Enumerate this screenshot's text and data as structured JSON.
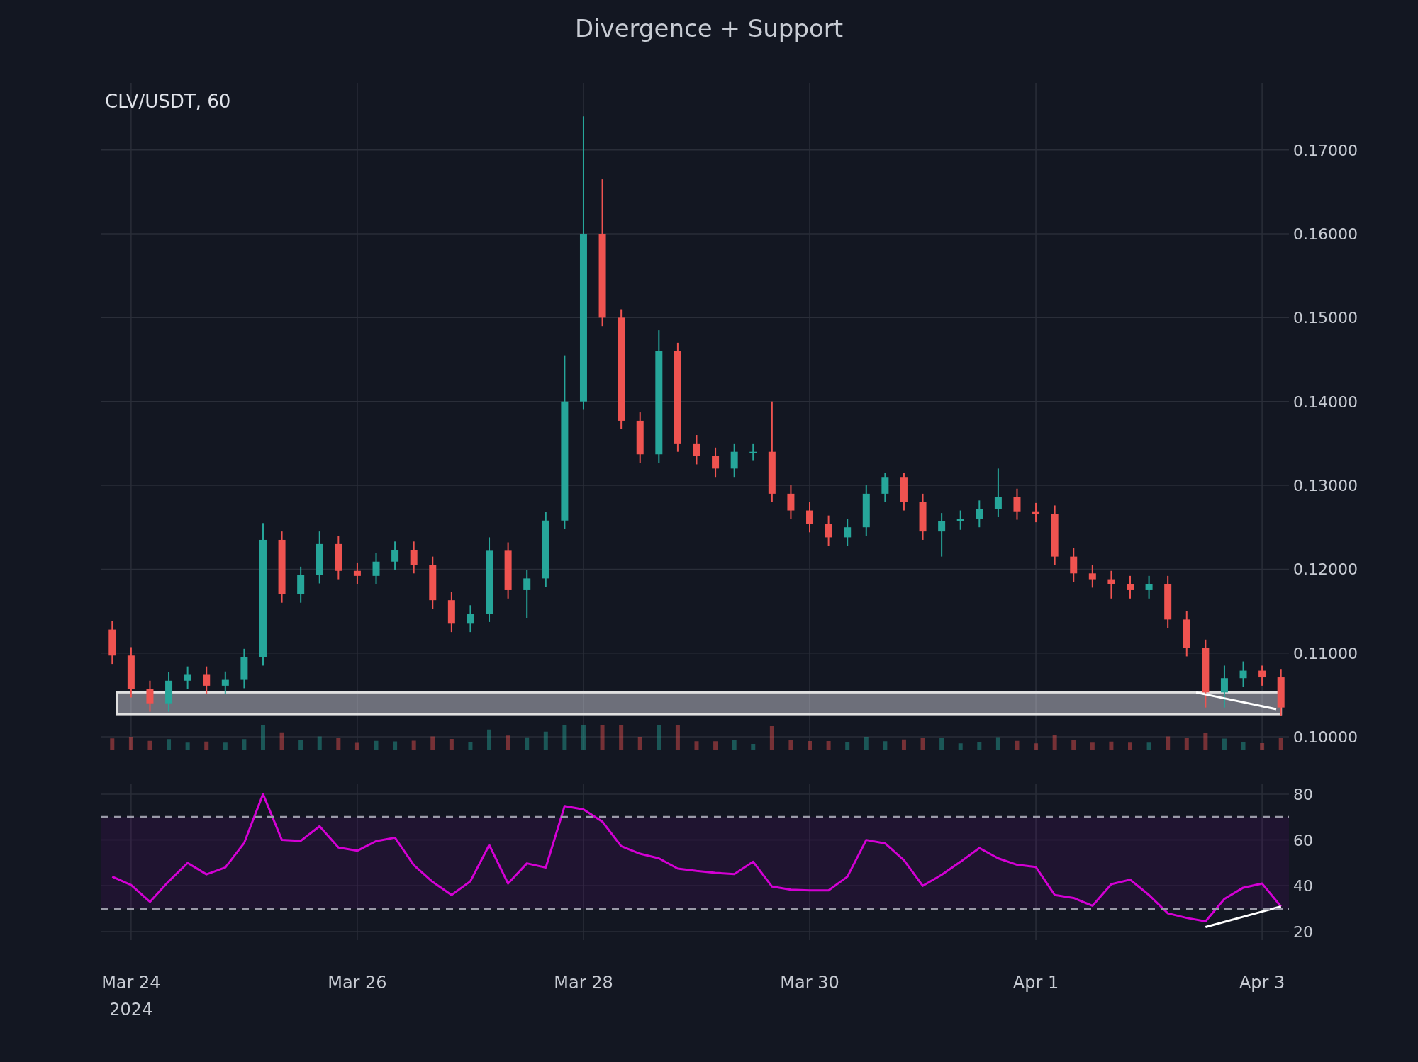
{
  "title": "Divergence + Support",
  "price_panel": {
    "chart_data": {
      "type": "candlestick",
      "title": "CLV/USDT, 60",
      "grid": true,
      "categories": [
        null,
        null,
        null,
        null,
        null,
        null,
        null,
        null,
        null,
        null,
        null,
        null,
        null,
        null,
        null,
        null,
        null,
        null,
        null,
        null,
        null,
        null,
        null,
        null,
        null,
        null,
        null,
        null,
        null,
        null,
        null,
        null,
        null,
        null,
        null,
        null,
        null,
        null,
        null,
        null,
        null,
        null,
        null,
        null,
        null,
        null,
        null,
        null,
        null,
        null,
        null,
        null,
        null,
        null,
        null,
        null,
        null,
        null,
        null,
        null,
        null,
        null,
        null
      ],
      "ohlc": [
        [
          0.1128,
          0.1138,
          0.1087,
          0.1097
        ],
        [
          0.1097,
          0.1107,
          0.1047,
          0.1057
        ],
        [
          0.1057,
          0.1067,
          0.103,
          0.104
        ],
        [
          0.104,
          0.1077,
          0.103,
          0.1067
        ],
        [
          0.1067,
          0.1084,
          0.1057,
          0.1074
        ],
        [
          0.1074,
          0.1084,
          0.1051,
          0.1061
        ],
        [
          0.1061,
          0.1078,
          0.1051,
          0.1068
        ],
        [
          0.1068,
          0.1105,
          0.1058,
          0.1095
        ],
        [
          0.1095,
          0.1255,
          0.1085,
          0.1235
        ],
        [
          0.1235,
          0.1245,
          0.116,
          0.117
        ],
        [
          0.117,
          0.1203,
          0.116,
          0.1193
        ],
        [
          0.1193,
          0.1245,
          0.1183,
          0.123
        ],
        [
          0.123,
          0.124,
          0.1188,
          0.1198
        ],
        [
          0.1198,
          0.1208,
          0.1182,
          0.1192
        ],
        [
          0.1192,
          0.1219,
          0.1182,
          0.1209
        ],
        [
          0.1209,
          0.1233,
          0.1199,
          0.1223
        ],
        [
          0.1223,
          0.1233,
          0.1195,
          0.1205
        ],
        [
          0.1205,
          0.1215,
          0.1153,
          0.1163
        ],
        [
          0.1163,
          0.1173,
          0.1125,
          0.1135
        ],
        [
          0.1135,
          0.1157,
          0.1125,
          0.1147
        ],
        [
          0.1147,
          0.1238,
          0.1137,
          0.1222
        ],
        [
          0.1222,
          0.1232,
          0.1165,
          0.1175
        ],
        [
          0.1175,
          0.1199,
          0.1142,
          0.1189
        ],
        [
          0.1189,
          0.1268,
          0.1179,
          0.1258
        ],
        [
          0.1258,
          0.1455,
          0.1248,
          0.14
        ],
        [
          0.14,
          0.174,
          0.139,
          0.16
        ],
        [
          0.16,
          0.1665,
          0.149,
          0.15
        ],
        [
          0.15,
          0.151,
          0.1367,
          0.1377
        ],
        [
          0.1377,
          0.1387,
          0.1327,
          0.1337
        ],
        [
          0.1337,
          0.1485,
          0.1327,
          0.146
        ],
        [
          0.146,
          0.147,
          0.134,
          0.135
        ],
        [
          0.135,
          0.136,
          0.1325,
          0.1335
        ],
        [
          0.1335,
          0.1345,
          0.131,
          0.132
        ],
        [
          0.132,
          0.135,
          0.131,
          0.134
        ],
        [
          0.134,
          0.135,
          0.133,
          0.134
        ],
        [
          0.134,
          0.14,
          0.128,
          0.129
        ],
        [
          0.129,
          0.13,
          0.126,
          0.127
        ],
        [
          0.127,
          0.128,
          0.1244,
          0.1254
        ],
        [
          0.1254,
          0.1264,
          0.1228,
          0.1238
        ],
        [
          0.1238,
          0.126,
          0.1228,
          0.125
        ],
        [
          0.125,
          0.13,
          0.124,
          0.129
        ],
        [
          0.129,
          0.1315,
          0.128,
          0.131
        ],
        [
          0.131,
          0.1315,
          0.127,
          0.128
        ],
        [
          0.128,
          0.129,
          0.1235,
          0.1245
        ],
        [
          0.1245,
          0.1267,
          0.1215,
          0.1257
        ],
        [
          0.1257,
          0.127,
          0.1247,
          0.126
        ],
        [
          0.126,
          0.1282,
          0.125,
          0.1272
        ],
        [
          0.1272,
          0.132,
          0.1262,
          0.1286
        ],
        [
          0.1286,
          0.1296,
          0.1259,
          0.1269
        ],
        [
          0.1269,
          0.1279,
          0.1256,
          0.1266
        ],
        [
          0.1266,
          0.1276,
          0.1205,
          0.1215
        ],
        [
          0.1215,
          0.1225,
          0.1185,
          0.1195
        ],
        [
          0.1195,
          0.1205,
          0.1178,
          0.1188
        ],
        [
          0.1188,
          0.1198,
          0.1165,
          0.1182
        ],
        [
          0.1182,
          0.1192,
          0.1165,
          0.1175
        ],
        [
          0.1175,
          0.1192,
          0.1165,
          0.1182
        ],
        [
          0.1182,
          0.1192,
          0.113,
          0.114
        ],
        [
          0.114,
          0.115,
          0.1096,
          0.1106
        ],
        [
          0.1106,
          0.1116,
          0.1035,
          0.1053
        ],
        [
          0.1053,
          0.1085,
          0.1035,
          0.107
        ],
        [
          0.107,
          0.109,
          0.106,
          0.1079
        ],
        [
          0.1079,
          0.1085,
          0.1061,
          0.1071
        ],
        [
          0.1071,
          0.1081,
          0.1025,
          0.1035
        ]
      ],
      "ylim": [
        0.0984,
        0.178
      ],
      "yticks": [
        {
          "value": 0.1,
          "label": "0.10000"
        },
        {
          "value": 0.11,
          "label": "0.11000"
        },
        {
          "value": 0.12,
          "label": "0.12000"
        },
        {
          "value": 0.13,
          "label": "0.13000"
        },
        {
          "value": 0.14,
          "label": "0.14000"
        },
        {
          "value": 0.15,
          "label": "0.15000"
        },
        {
          "value": 0.16,
          "label": "0.16000"
        },
        {
          "value": 0.17,
          "label": "0.17000"
        }
      ]
    },
    "support_zone": {
      "kind": "zone"
    },
    "divergence_line": {
      "kind": "trendline"
    }
  },
  "rsi_panel": {
    "chart_data": {
      "type": "line",
      "grid": true,
      "categories": [
        null,
        "Mar 24",
        null,
        null,
        null,
        null,
        null,
        null,
        null,
        null,
        null,
        null,
        null,
        "Mar 26",
        null,
        null,
        null,
        null,
        null,
        null,
        null,
        null,
        null,
        null,
        null,
        "Mar 28",
        null,
        null,
        null,
        null,
        null,
        null,
        null,
        null,
        null,
        null,
        null,
        "Mar 30",
        null,
        null,
        null,
        null,
        null,
        null,
        null,
        null,
        null,
        null,
        null,
        "Apr 1",
        null,
        null,
        null,
        null,
        null,
        null,
        null,
        null,
        null,
        null,
        null,
        "Apr 3",
        null
      ],
      "series": [
        {
          "color": "#d400d4",
          "values": [
            44,
            40.4,
            33,
            42,
            50,
            45,
            48,
            58.7,
            80,
            60,
            59.6,
            66,
            56.7,
            55.3,
            59.5,
            61,
            49,
            41.7,
            36,
            42,
            57.8,
            41,
            49.8,
            48,
            74.8,
            73.3,
            68,
            57.3,
            54,
            52,
            47.5,
            46.5,
            45.7,
            45.1,
            50.5,
            39.7,
            38.3,
            38,
            38,
            44,
            60,
            58.5,
            51.2,
            40,
            44.8,
            50.5,
            56.5,
            52,
            49.2,
            48.2,
            36,
            34.7,
            31.3,
            40.7,
            42.7,
            36,
            28,
            26,
            24.5,
            34.3,
            39.2,
            41,
            31
          ]
        },
        {
          "color": "#ffffff",
          "values": [
            null,
            null,
            null,
            null,
            null,
            null,
            null,
            null,
            null,
            null,
            null,
            null,
            null,
            null,
            null,
            null,
            null,
            null,
            null,
            null,
            null,
            null,
            null,
            null,
            null,
            null,
            null,
            null,
            null,
            null,
            null,
            null,
            null,
            null,
            null,
            null,
            null,
            null,
            null,
            null,
            null,
            null,
            null,
            null,
            null,
            null,
            null,
            null,
            null,
            null,
            null,
            null,
            null,
            null,
            null,
            null,
            null,
            null,
            22,
            null,
            null,
            null,
            31
          ]
        }
      ],
      "ylim": [
        16.3,
        84.3
      ],
      "yticks": [
        20,
        40,
        60,
        80
      ]
    },
    "threshold_lines": {
      "kind": "band"
    },
    "year_label": "2024"
  }
}
